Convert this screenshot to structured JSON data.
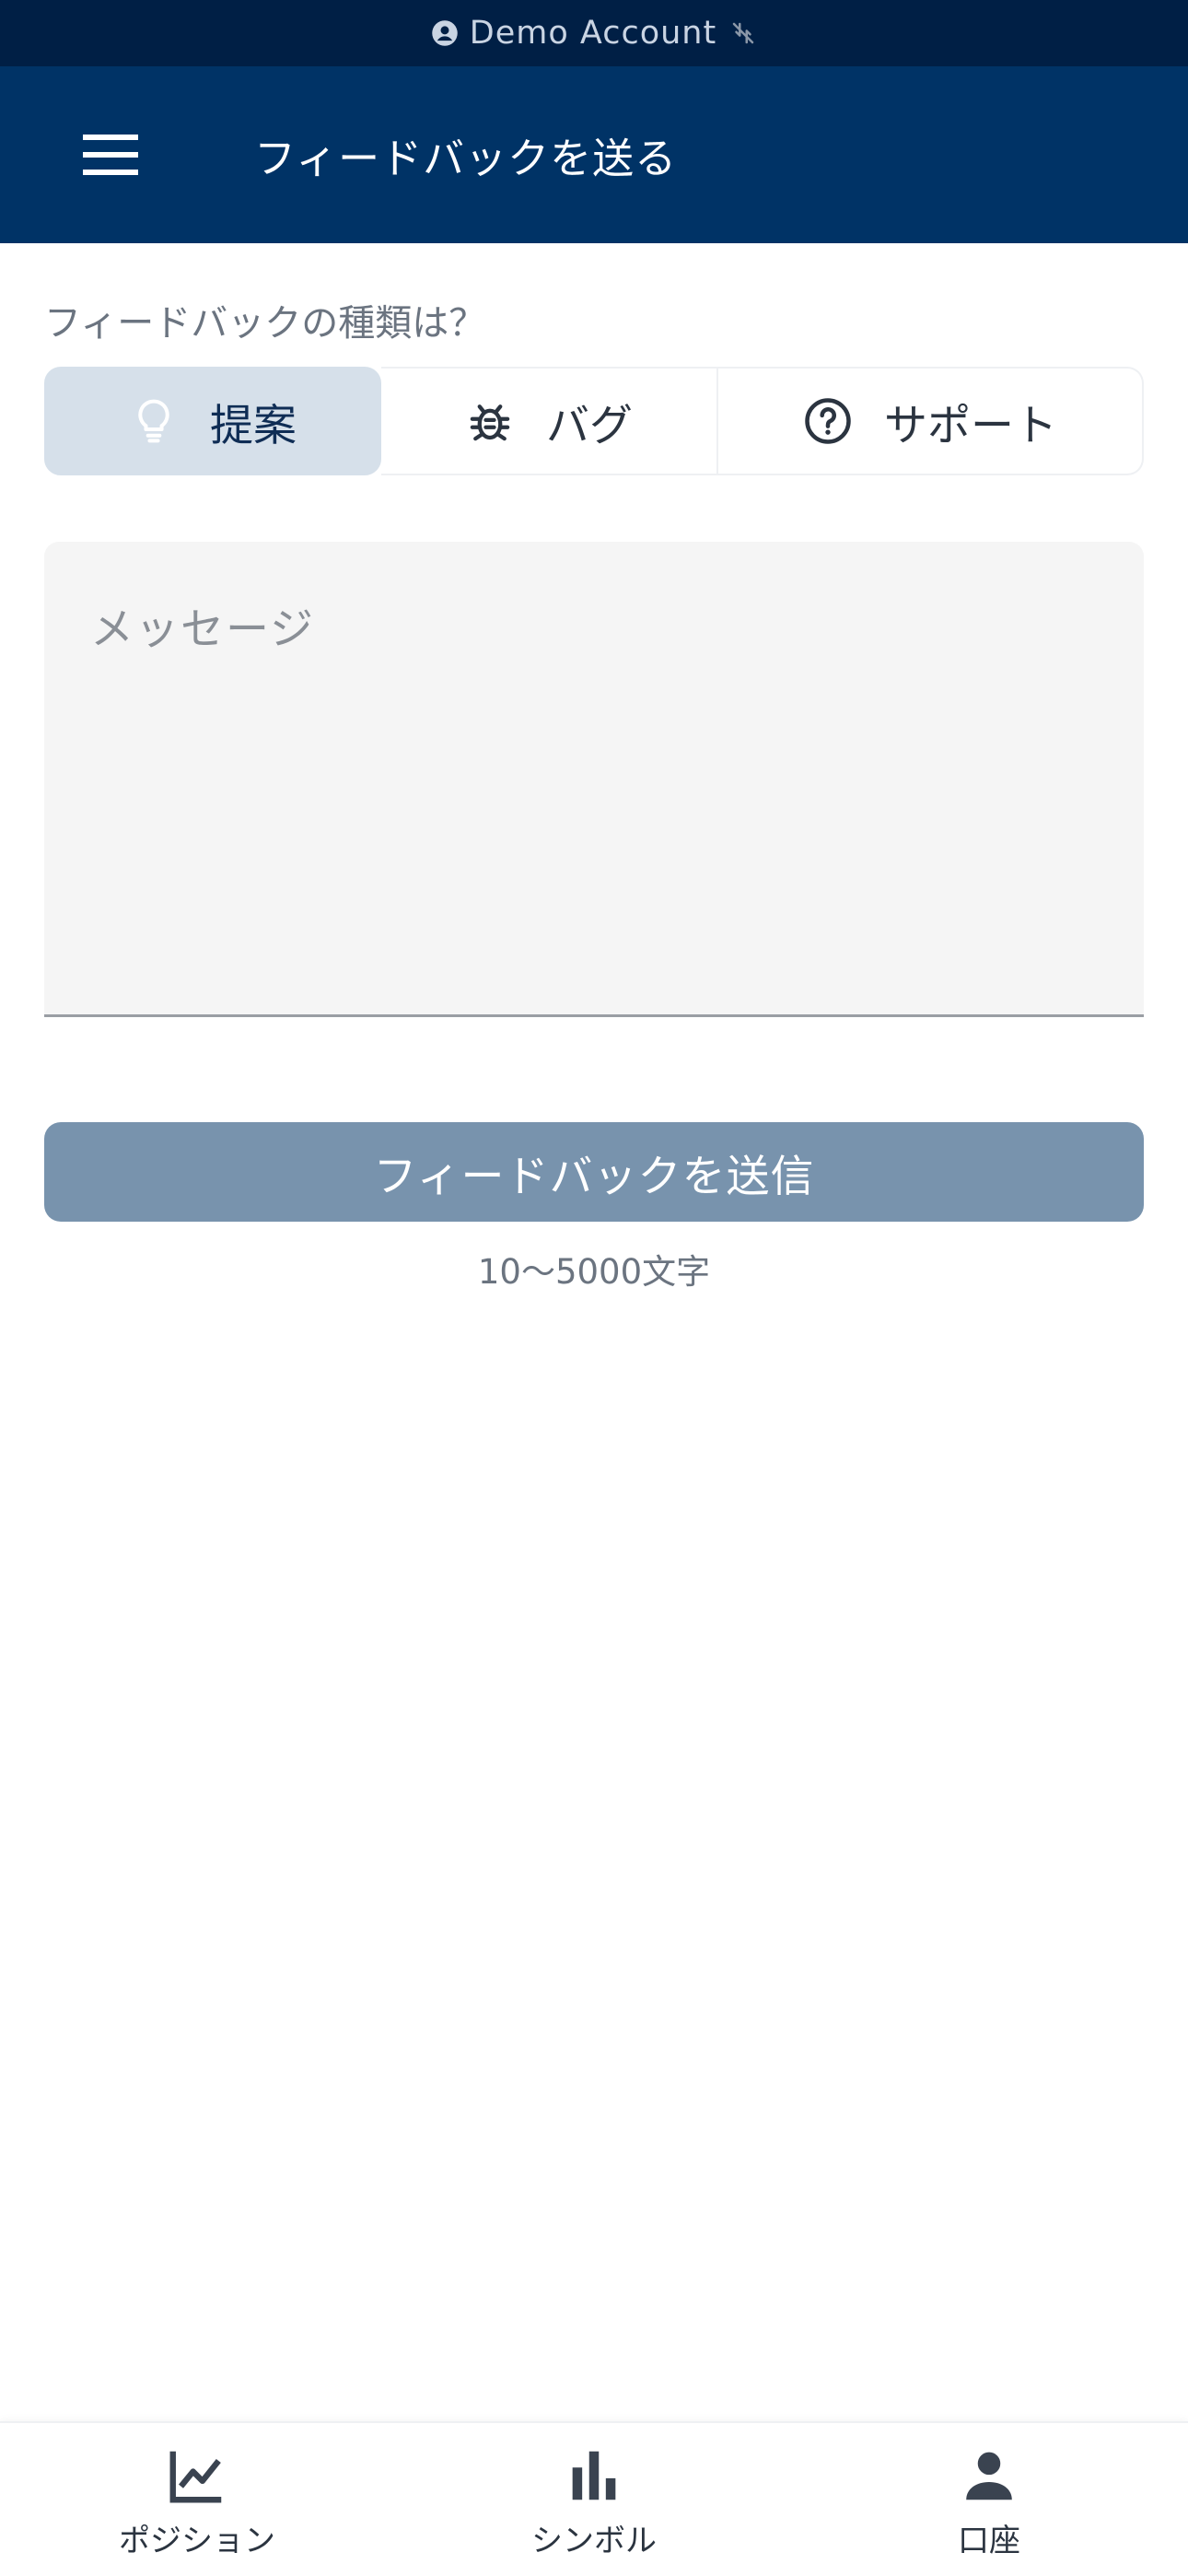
{
  "demo_bar": {
    "label": "Demo Account",
    "icons": [
      "account-circle-icon",
      "no-connection-icon"
    ]
  },
  "app_bar": {
    "title": "フィードバックを送る",
    "menu_icon": "hamburger-menu-icon"
  },
  "feedback_type": {
    "question": "フィードバックの種類は？",
    "options": [
      {
        "label": "提案",
        "icon": "lightbulb-icon",
        "selected": true
      },
      {
        "label": "バグ",
        "icon": "bug-icon",
        "selected": false
      },
      {
        "label": "サポート",
        "icon": "help-circle-icon",
        "selected": false
      }
    ]
  },
  "message": {
    "placeholder": "メッセージ",
    "value": ""
  },
  "submit": {
    "label": "フィードバックを送信",
    "hint": "10〜5000文字",
    "enabled": false
  },
  "bottom_nav": {
    "items": [
      {
        "label": "ポジション",
        "icon": "line-chart-icon"
      },
      {
        "label": "シンボル",
        "icon": "bar-chart-icon"
      },
      {
        "label": "口座",
        "icon": "person-icon"
      }
    ]
  },
  "colors": {
    "status_bar": "#001f45",
    "app_bar": "#003366",
    "selected_segment": "#d6e0ea",
    "submit_disabled": "#7893ad",
    "field_bg": "#f5f5f5"
  }
}
